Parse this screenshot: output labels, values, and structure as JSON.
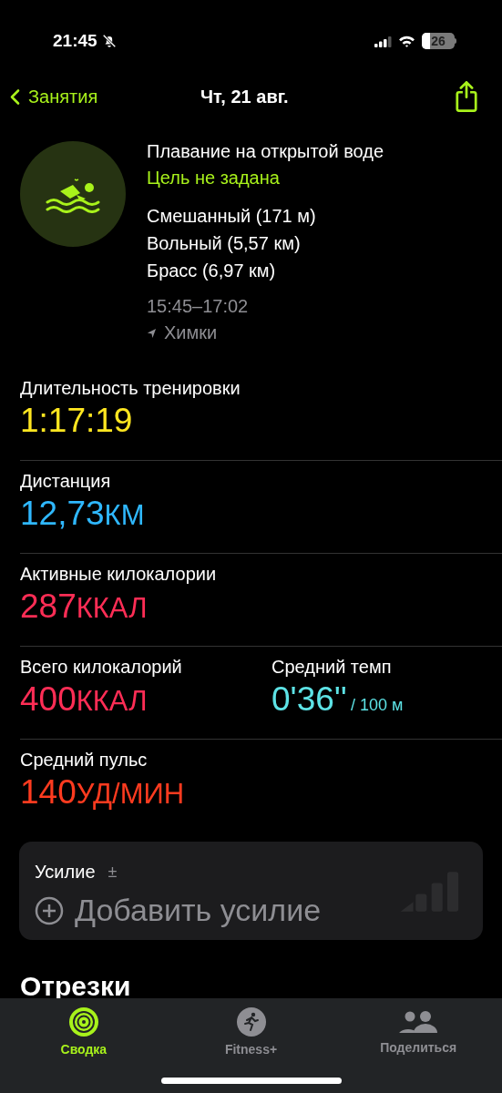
{
  "status_bar": {
    "time": "21:45",
    "battery": "26"
  },
  "nav": {
    "back": "Занятия",
    "title": "Чт, 21 авг."
  },
  "workout": {
    "title": "Плавание на открытой воде",
    "goal": "Цель не задана",
    "strokes": [
      "Смешанный (171 м)",
      "Вольный (5,57 км)",
      "Брасс (6,97 км)"
    ],
    "time_range": "15:45–17:02",
    "location": "Химки"
  },
  "metrics": [
    [
      {
        "label": "Длительность тренировки",
        "value": "1:17:19",
        "color": "#ffe620"
      }
    ],
    [
      {
        "label": "Дистанция",
        "value": "12,73",
        "unit": "КМ",
        "color": "#2fb8ff"
      }
    ],
    [
      {
        "label": "Активные килокалории",
        "value": "287",
        "unit": "ККАЛ",
        "color": "#ff2d55"
      }
    ],
    [
      {
        "label": "Всего килокалорий",
        "value": "400",
        "unit": "ККАЛ",
        "color": "#ff2d55"
      },
      {
        "label": "Средний темп",
        "value": "0'36''",
        "suffix": "/ 100 м",
        "color": "#5de3e6"
      }
    ],
    [
      {
        "label": "Средний пульс",
        "value": "140",
        "unit": "УД/МИН",
        "color": "#ff3b1f"
      }
    ]
  ],
  "effort": {
    "label": "Усилие",
    "sign": "±",
    "action": "Добавить усилие"
  },
  "next_section": "Отрезки",
  "tabs": [
    {
      "label": "Сводка",
      "selected": true,
      "kind": "rings"
    },
    {
      "label": "Fitness+",
      "selected": false,
      "kind": "runner"
    },
    {
      "label": "Поделиться",
      "selected": false,
      "kind": "people"
    }
  ]
}
